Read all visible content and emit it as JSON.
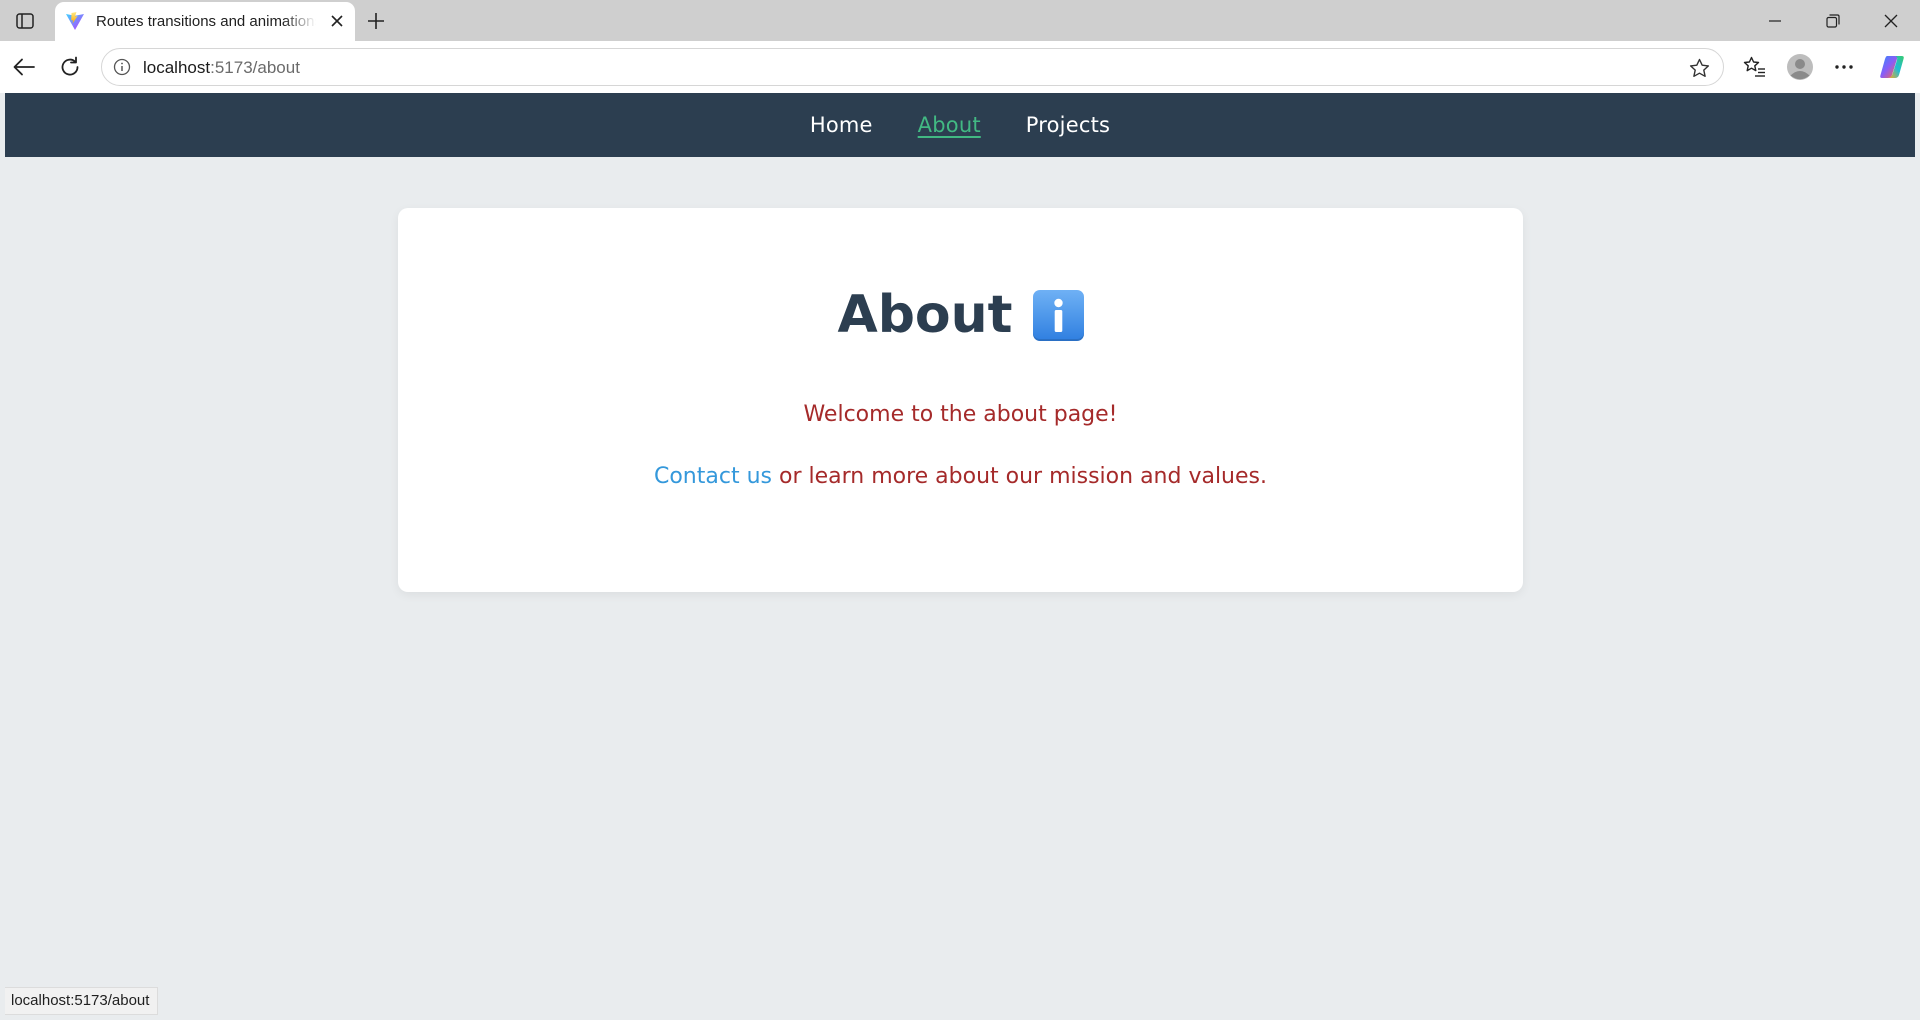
{
  "browser": {
    "tab": {
      "title": "Routes transitions and animations"
    },
    "address": {
      "host": "localhost",
      "path": ":5173/about"
    },
    "status_url": "localhost:5173/about"
  },
  "nav": {
    "items": [
      {
        "label": "Home"
      },
      {
        "label": "About"
      },
      {
        "label": "Projects"
      }
    ],
    "active": "About"
  },
  "page": {
    "heading": "About",
    "welcome": "Welcome to the about page!",
    "contact_link": "Contact us",
    "contact_rest": " or learn more about our mission and values."
  },
  "colors": {
    "nav_bg": "#2c3e50",
    "nav_active": "#42b983",
    "heading": "#2c3e50",
    "body_text": "#a52a2a",
    "link": "#3498db",
    "page_bg": "#e9ecee"
  },
  "icons": {
    "heading_icon": "information-emoji-icon"
  }
}
